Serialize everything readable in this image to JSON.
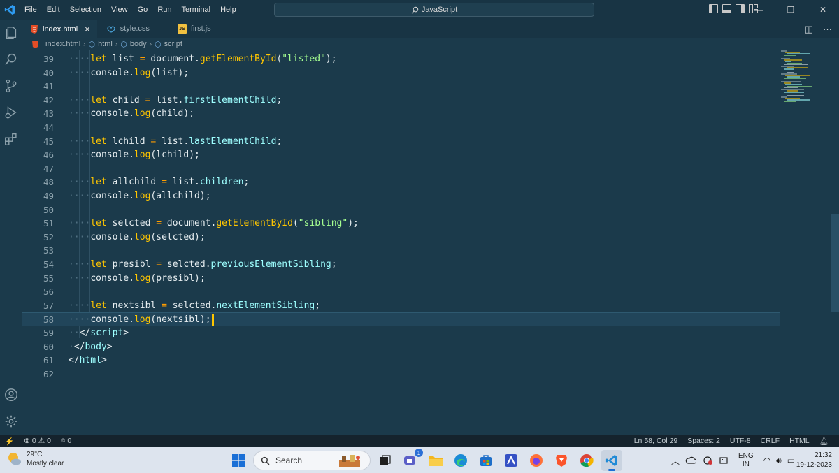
{
  "menu": [
    "File",
    "Edit",
    "Selection",
    "View",
    "Go",
    "Run",
    "Terminal",
    "Help"
  ],
  "command_center": "JavaScript",
  "tabs": [
    {
      "label": "index.html",
      "icon": "html-file-icon",
      "close": "×",
      "active": true
    },
    {
      "label": "style.css",
      "icon": "css-file-icon",
      "active": false
    },
    {
      "label": "first.js",
      "icon": "js-file-icon",
      "active": false
    }
  ],
  "breadcrumb": [
    "index.html",
    "html",
    "body",
    "script"
  ],
  "editor": {
    "cursor_line": 58,
    "lines": [
      {
        "n": "39",
        "indent": 4,
        "tokens": [
          [
            "k",
            "let"
          ],
          [
            "v",
            " list "
          ],
          [
            "o",
            "="
          ],
          [
            "v",
            " document."
          ],
          [
            "f",
            "getElementById"
          ],
          [
            "p",
            "("
          ],
          [
            "s",
            "\"listed\""
          ],
          [
            "p",
            ");"
          ]
        ]
      },
      {
        "n": "40",
        "indent": 4,
        "tokens": [
          [
            "v",
            "console."
          ],
          [
            "f",
            "log"
          ],
          [
            "p",
            "(list);"
          ]
        ]
      },
      {
        "n": "41",
        "indent": 0,
        "tokens": []
      },
      {
        "n": "42",
        "indent": 4,
        "tokens": [
          [
            "k",
            "let"
          ],
          [
            "v",
            " child "
          ],
          [
            "o",
            "="
          ],
          [
            "v",
            " list."
          ],
          [
            "pr",
            "firstElementChild"
          ],
          [
            "p",
            ";"
          ]
        ]
      },
      {
        "n": "43",
        "indent": 4,
        "tokens": [
          [
            "v",
            "console."
          ],
          [
            "f",
            "log"
          ],
          [
            "p",
            "(child);"
          ]
        ]
      },
      {
        "n": "44",
        "indent": 0,
        "tokens": []
      },
      {
        "n": "45",
        "indent": 4,
        "tokens": [
          [
            "k",
            "let"
          ],
          [
            "v",
            " lchild "
          ],
          [
            "o",
            "="
          ],
          [
            "v",
            " list."
          ],
          [
            "pr",
            "lastElementChild"
          ],
          [
            "p",
            ";"
          ]
        ]
      },
      {
        "n": "46",
        "indent": 4,
        "tokens": [
          [
            "v",
            "console."
          ],
          [
            "f",
            "log"
          ],
          [
            "p",
            "(lchild);"
          ]
        ]
      },
      {
        "n": "47",
        "indent": 0,
        "tokens": []
      },
      {
        "n": "48",
        "indent": 4,
        "tokens": [
          [
            "k",
            "let"
          ],
          [
            "v",
            " allchild "
          ],
          [
            "o",
            "="
          ],
          [
            "v",
            " list."
          ],
          [
            "pr",
            "children"
          ],
          [
            "p",
            ";"
          ]
        ]
      },
      {
        "n": "49",
        "indent": 4,
        "tokens": [
          [
            "v",
            "console."
          ],
          [
            "f",
            "log"
          ],
          [
            "p",
            "(allchild);"
          ]
        ]
      },
      {
        "n": "50",
        "indent": 0,
        "tokens": []
      },
      {
        "n": "51",
        "indent": 4,
        "tokens": [
          [
            "k",
            "let"
          ],
          [
            "v",
            " selcted "
          ],
          [
            "o",
            "="
          ],
          [
            "v",
            " document."
          ],
          [
            "f",
            "getElementById"
          ],
          [
            "p",
            "("
          ],
          [
            "s",
            "\"sibling\""
          ],
          [
            "p",
            ");"
          ]
        ]
      },
      {
        "n": "52",
        "indent": 4,
        "tokens": [
          [
            "v",
            "console."
          ],
          [
            "f",
            "log"
          ],
          [
            "p",
            "(selcted);"
          ]
        ]
      },
      {
        "n": "53",
        "indent": 0,
        "tokens": []
      },
      {
        "n": "54",
        "indent": 4,
        "tokens": [
          [
            "k",
            "let"
          ],
          [
            "v",
            " presibl "
          ],
          [
            "o",
            "="
          ],
          [
            "v",
            " selcted."
          ],
          [
            "pr",
            "previousElementSibling"
          ],
          [
            "p",
            ";"
          ]
        ]
      },
      {
        "n": "55",
        "indent": 4,
        "tokens": [
          [
            "v",
            "console."
          ],
          [
            "f",
            "log"
          ],
          [
            "p",
            "(presibl);"
          ]
        ]
      },
      {
        "n": "56",
        "indent": 0,
        "tokens": []
      },
      {
        "n": "57",
        "indent": 4,
        "tokens": [
          [
            "k",
            "let"
          ],
          [
            "v",
            " nextsibl "
          ],
          [
            "o",
            "="
          ],
          [
            "v",
            " selcted."
          ],
          [
            "pr",
            "nextElementSibling"
          ],
          [
            "p",
            ";"
          ]
        ]
      },
      {
        "n": "58",
        "indent": 4,
        "tokens": [
          [
            "v",
            "console."
          ],
          [
            "f",
            "log"
          ],
          [
            "p",
            "(nextsibl);"
          ]
        ]
      },
      {
        "n": "59",
        "indent": 2,
        "tokens": [
          [
            "p",
            "</"
          ],
          [
            "t",
            "script"
          ],
          [
            "p",
            ">"
          ]
        ]
      },
      {
        "n": "60",
        "indent": 1,
        "tokens": [
          [
            "p",
            "</"
          ],
          [
            "t",
            "body"
          ],
          [
            "p",
            ">"
          ]
        ]
      },
      {
        "n": "61",
        "indent": 0,
        "tokens": [
          [
            "p",
            "</"
          ],
          [
            "t",
            "html"
          ],
          [
            "p",
            ">"
          ]
        ]
      },
      {
        "n": "62",
        "indent": 0,
        "tokens": []
      }
    ]
  },
  "statusbar": {
    "errors": "0",
    "warnings": "0",
    "ports": "0",
    "position": "Ln 58, Col 29",
    "spaces": "Spaces: 2",
    "encoding": "UTF-8",
    "eol": "CRLF",
    "language": "HTML"
  },
  "taskbar": {
    "temperature": "29°C",
    "weather": "Mostly clear",
    "search_placeholder": "Search",
    "lang_line1": "ENG",
    "lang_line2": "IN",
    "time": "21:32",
    "date": "19-12-2023",
    "teams_badge": "1"
  },
  "colors": {
    "editor_bg": "#1b3a4b",
    "keyword": "#ffc600",
    "operator": "#ff9d00",
    "property": "#9effff",
    "string": "#a5ff90",
    "accent": "#2f89d6"
  }
}
